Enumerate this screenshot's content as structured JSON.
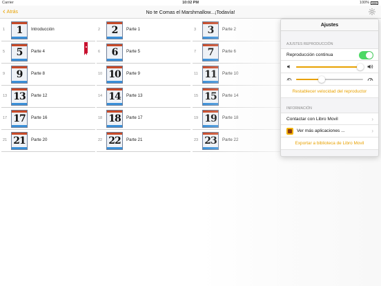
{
  "status_bar": {
    "carrier": "Carrier",
    "time": "10:02 PM",
    "battery": "100%"
  },
  "nav": {
    "back_label": "Atrás",
    "title": "No te Comas el Marshmallow...¡Todavía!"
  },
  "chapters": [
    {
      "index": "1",
      "number": "1",
      "label": "Introducción"
    },
    {
      "index": "2",
      "number": "2",
      "label": "Parte 1"
    },
    {
      "index": "3",
      "number": "3",
      "label": "Parte 2"
    },
    {
      "index": "5",
      "number": "5",
      "label": "Parte 4"
    },
    {
      "index": "6",
      "number": "6",
      "label": "Parte 5"
    },
    {
      "index": "7",
      "number": "7",
      "label": "Parte 6"
    },
    {
      "index": "9",
      "number": "9",
      "label": "Parte 8"
    },
    {
      "index": "10",
      "number": "10",
      "label": "Parte 9"
    },
    {
      "index": "11",
      "number": "11",
      "label": "Parte 10"
    },
    {
      "index": "13",
      "number": "13",
      "label": "Parte 12"
    },
    {
      "index": "14",
      "number": "14",
      "label": "Parte 13"
    },
    {
      "index": "15",
      "number": "15",
      "label": "Parte 14"
    },
    {
      "index": "17",
      "number": "17",
      "label": "Parte 16"
    },
    {
      "index": "18",
      "number": "18",
      "label": "Parte 17"
    },
    {
      "index": "19",
      "number": "19",
      "label": "Parte 18"
    },
    {
      "index": "21",
      "number": "21",
      "label": "Parte 20"
    },
    {
      "index": "22",
      "number": "22",
      "label": "Parte 21"
    },
    {
      "index": "23",
      "number": "23",
      "label": "Parte 22"
    }
  ],
  "bookmarked_chapter": "5",
  "settings": {
    "title": "Ajustes",
    "playback_section": "AJUSTES REPRODUCCIÓN",
    "continuous_label": "Reproducción continua",
    "continuous_on": true,
    "volume_level": 0.96,
    "speed_level": 0.38,
    "reset_speed_label": "Restablecer velocidad del reproductor",
    "info_section": "INFORMACIÓN",
    "contact_label": "Contactar con Libro Movil",
    "more_apps_label": "Ver más aplicaciones ...",
    "export_label": "Exportar a biblioteca de Libro Movil"
  },
  "colors": {
    "accent": "#e8a100",
    "toggle_on": "#4cd964",
    "bookmark": "#c8102e"
  }
}
